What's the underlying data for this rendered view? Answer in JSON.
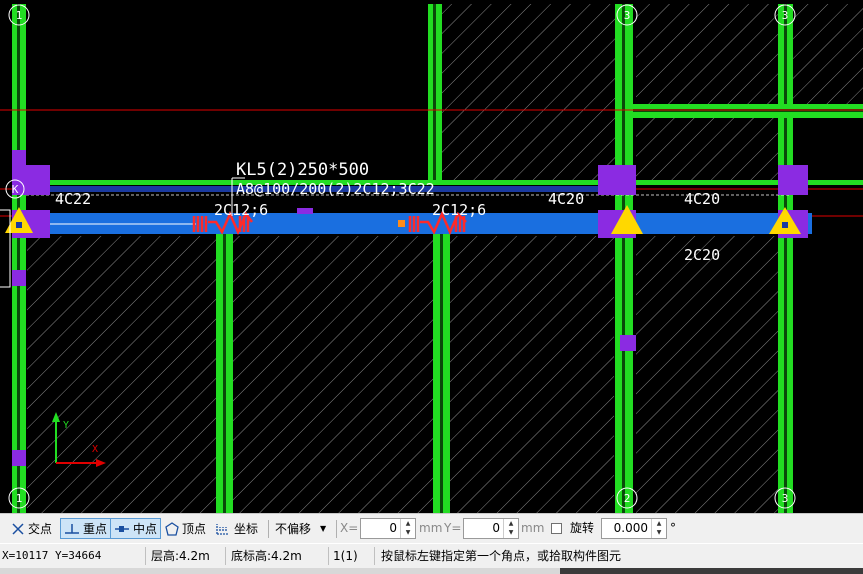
{
  "drawing": {
    "beam_label": "KL5(2)250*500",
    "beam_stirrup": "A8@100/200(2)2C12;3C22",
    "rebar_left_top": "4C22",
    "rebar_left_mid": "2C12;6",
    "rebar_center_mid": "2C12;6",
    "rebar_right_a": "4C20",
    "rebar_right_b": "4C20",
    "rebar_right_bottom": "2C20",
    "axis_k": "K",
    "axis_top_left": "1",
    "axis_top_right_a": "3",
    "axis_top_right_b": "3",
    "axis_bottom_left": "1",
    "axis_bottom_right_a": "2",
    "axis_bottom_right_b": "3",
    "ucs_y": "Y",
    "ucs_x": "X",
    "colors": {
      "column_green": "#22dd22",
      "beam_blue": "#1a6fe0",
      "support_purple": "#8b2be2",
      "rebar_red": "#ff2a2a",
      "triangle_yellow": "#ffd800",
      "axis_line": "#e00000"
    }
  },
  "snap_toolbar": {
    "intersection": {
      "label": "交点",
      "icon": "intersection-icon"
    },
    "perpendicular": {
      "label": "重点",
      "icon": "perpendicular-icon"
    },
    "midpoint": {
      "label": "中点",
      "icon": "midpoint-icon"
    },
    "vertex": {
      "label": "顶点",
      "icon": "pentagon-icon"
    },
    "coordinate": {
      "label": "坐标",
      "icon": "coordinate-icon"
    },
    "offset_select": "不偏移",
    "x_label": "X=",
    "x_value": "0",
    "unit": "mm",
    "y_label": "Y=",
    "y_value": "0",
    "rotate_label": "旋转",
    "rotate_value": "0.000",
    "degree": "°"
  },
  "status_bar": {
    "coords": "X=10117 Y=34664",
    "floor_height": "层高:4.2m",
    "base_height": "底标高:4.2m",
    "layer": "1(1)",
    "prompt": "按鼠标左键指定第一个角点，或拾取构件图元"
  }
}
